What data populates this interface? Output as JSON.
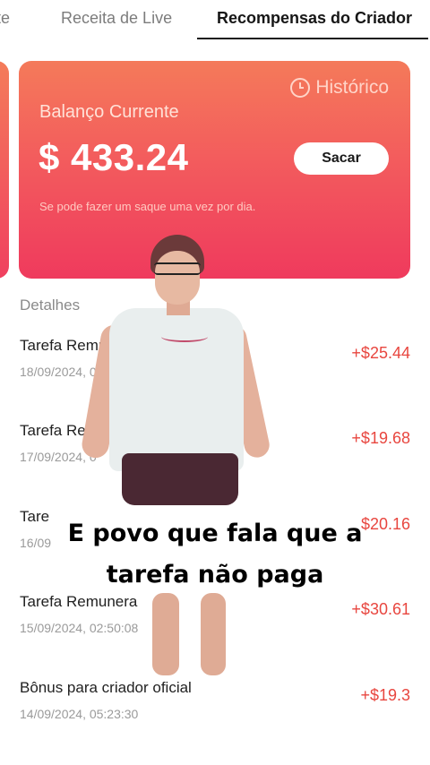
{
  "tabs": [
    {
      "label": "nte"
    },
    {
      "label": "Receita de Live"
    },
    {
      "label": "Recompensas do Criador"
    }
  ],
  "card": {
    "history_label": "Histórico",
    "balance_label": "Balanço Currente",
    "balance_value": "$ 433.24",
    "withdraw_label": "Sacar",
    "note": "Se pode fazer um saque uma vez por dia."
  },
  "details": {
    "title": "Detalhes",
    "rows": [
      {
        "title": "Tarefa Remu",
        "date": "18/09/2024, 0",
        "amount": "+$25.44"
      },
      {
        "title": "Tarefa Rem",
        "date": "17/09/2024, 0",
        "amount": "+$19.68"
      },
      {
        "title": "Tare",
        "date": "16/09",
        "amount": "$20.16"
      },
      {
        "title": "Tarefa Remunera",
        "date": "15/09/2024, 02:50:08",
        "amount": "+$30.61"
      },
      {
        "title": "Bônus para criador oficial",
        "date": "14/09/2024, 05:23:30",
        "amount": "+$19.3"
      }
    ]
  },
  "caption": {
    "line1": "E povo que fala que a",
    "line2": "tarefa não paga"
  },
  "colors": {
    "accent": "#ef3a5d",
    "amount": "#e8463f"
  }
}
